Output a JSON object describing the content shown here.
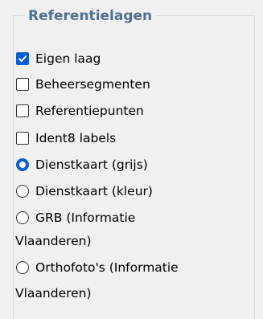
{
  "panel": {
    "legend": "Referentielagen"
  },
  "options": [
    {
      "type": "checkbox",
      "label": "Eigen laag",
      "checked": true
    },
    {
      "type": "checkbox",
      "label": "Beheersegmenten",
      "checked": false
    },
    {
      "type": "checkbox",
      "label": "Referentiepunten",
      "checked": false
    },
    {
      "type": "checkbox",
      "label": "Ident8 labels",
      "checked": false
    },
    {
      "type": "radio",
      "label": "Dienstkaart (grijs)",
      "checked": true
    },
    {
      "type": "radio",
      "label": "Dienstkaart (kleur)",
      "checked": false
    },
    {
      "type": "radio",
      "label": "GRB (Informatie",
      "continuation": "Vlaanderen)",
      "checked": false
    },
    {
      "type": "radio",
      "label": "Orthofoto's (Informatie",
      "continuation": "Vlaanderen)",
      "checked": false
    }
  ],
  "colors": {
    "accent": "#0a5fd0",
    "legend": "#4f6f93",
    "background": "#f0f0f0"
  }
}
